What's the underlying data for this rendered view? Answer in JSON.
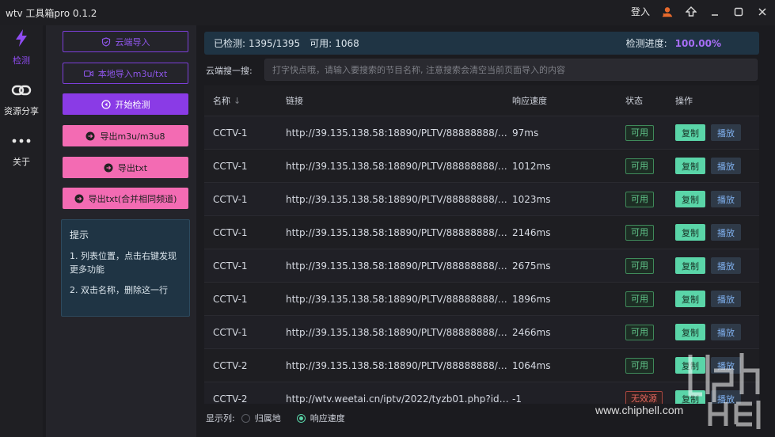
{
  "window": {
    "title": "wtv 工具箱pro 0.1.2",
    "login_label": "登入"
  },
  "nav": {
    "items": [
      {
        "label": "检测",
        "icon": "lightning-icon",
        "active": true
      },
      {
        "label": "资源分享",
        "icon": "link-icon"
      },
      {
        "label": "关于",
        "icon": "more-dots-icon"
      }
    ]
  },
  "sidebar": {
    "buttons": [
      {
        "label": "云端导入",
        "icon": "shield-icon",
        "style": "outline"
      },
      {
        "label": "本地导入m3u/txt",
        "icon": "video-icon",
        "style": "outline"
      },
      {
        "label": "开始检测",
        "icon": "play-circle-icon",
        "style": "purple"
      },
      {
        "label": "导出m3u/m3u8",
        "icon": "export-icon",
        "style": "pink"
      },
      {
        "label": "导出txt",
        "icon": "export-icon",
        "style": "pink"
      },
      {
        "label": "导出txt(合并相同频道)",
        "icon": "export-icon",
        "style": "pink"
      }
    ],
    "tips": {
      "title": "提示",
      "items": [
        "1. 列表位置，点击右键发现更多功能",
        "2. 双击名称，删除这一行"
      ]
    }
  },
  "status": {
    "checked_label": "已检测:",
    "checked_value": "1395/1395",
    "available_label": "可用:",
    "available_value": "1068",
    "progress_label": "检测进度:",
    "progress_value": "100.00%"
  },
  "search": {
    "label": "云端搜一搜:",
    "placeholder": "打字快点哦，请输入要搜索的节目名称, 注意搜索会清空当前页面导入的内容"
  },
  "table": {
    "headers": {
      "name": "名称",
      "link": "链接",
      "response": "响应速度",
      "status": "状态",
      "ops": "操作"
    },
    "copy_label": "复制",
    "play_label": "播放",
    "rows": [
      {
        "name": "CCTV-1",
        "link": "http://39.135.138.58:18890/PLTV/88888888/224...",
        "response": "97ms",
        "status": "可用",
        "ok": true
      },
      {
        "name": "CCTV-1",
        "link": "http://39.135.138.58:18890/PLTV/88888888/224...",
        "response": "1012ms",
        "status": "可用",
        "ok": true
      },
      {
        "name": "CCTV-1",
        "link": "http://39.135.138.58:18890/PLTV/88888888/224...",
        "response": "1023ms",
        "status": "可用",
        "ok": true
      },
      {
        "name": "CCTV-1",
        "link": "http://39.135.138.58:18890/PLTV/88888888/224...",
        "response": "2146ms",
        "status": "可用",
        "ok": true
      },
      {
        "name": "CCTV-1",
        "link": "http://39.135.138.58:18890/PLTV/88888888/224...",
        "response": "2675ms",
        "status": "可用",
        "ok": true
      },
      {
        "name": "CCTV-1",
        "link": "http://39.135.138.58:18890/PLTV/88888888/224...",
        "response": "1896ms",
        "status": "可用",
        "ok": true
      },
      {
        "name": "CCTV-1",
        "link": "http://39.135.138.58:18890/PLTV/88888888/224...",
        "response": "2466ms",
        "status": "可用",
        "ok": true
      },
      {
        "name": "CCTV-2",
        "link": "http://39.135.138.58:18890/PLTV/88888888/224...",
        "response": "1064ms",
        "status": "可用",
        "ok": true
      },
      {
        "name": "CCTV-2",
        "link": "http://wtv.weetai.cn/iptv/2022/tyzb01.php?id=c...",
        "response": "-1",
        "status": "无效源",
        "ok": false
      }
    ]
  },
  "columns": {
    "label": "显示列:",
    "options": [
      {
        "label": "归属地",
        "checked": false
      },
      {
        "label": "响应速度",
        "checked": true
      }
    ]
  },
  "watermark": {
    "text": "www.chiphell.com"
  },
  "colors": {
    "accent": "#8a3be6",
    "pink": "#f36bb3",
    "mint": "#5ad5a8",
    "panel": "#1f3444"
  }
}
